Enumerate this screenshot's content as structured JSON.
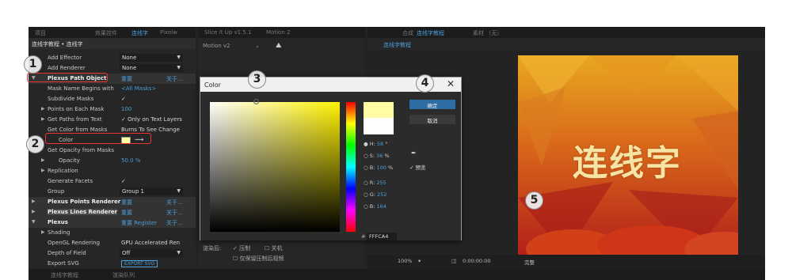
{
  "effect_panel": {
    "tabs": [
      "项目",
      "效果控件",
      "连线字",
      "Pixelw"
    ],
    "title": "连线字教程 • 连线字",
    "rows": [
      {
        "label": "Add Effector",
        "value": "None"
      },
      {
        "label": "Add Renderer",
        "value": "None"
      },
      {
        "label": "Plexus Path Object",
        "value": "重置",
        "extra": "关于..."
      },
      {
        "label": "Mask Name Begins with",
        "value": "<All Masks>"
      },
      {
        "label": "Subdivide Masks",
        "value": "✓"
      },
      {
        "label": "Points on Each Mask",
        "value": "100"
      },
      {
        "label": "Get Paths from Text",
        "value": "✓ Only on Text Layers"
      },
      {
        "label": "Get Color from Masks",
        "value": "Burns To See Change"
      },
      {
        "label": "Color",
        "value": ""
      },
      {
        "label": "Get Opacity from Masks",
        "value": ""
      },
      {
        "label": "Opacity",
        "value": "50.0 %"
      },
      {
        "label": "Replication",
        "value": ""
      },
      {
        "label": "Generate Facets",
        "value": "✓"
      },
      {
        "label": "Group",
        "value": "Group 1"
      },
      {
        "label": "Plexus Points Renderer",
        "value": "重置",
        "extra": "关于..."
      },
      {
        "label": "Plexus Lines Renderer",
        "value": "重置",
        "extra": "关于..."
      },
      {
        "label": "Plexus",
        "value": "重置  Register",
        "extra": "关于..."
      },
      {
        "label": "Shading",
        "value": ""
      },
      {
        "label": "OpenGL Rendering",
        "value": "GPU Accelerated Ren"
      },
      {
        "label": "Depth of Field",
        "value": "Off"
      },
      {
        "label": "Export SVG",
        "value": "EXPORT SVG"
      }
    ]
  },
  "middle_panel": {
    "tabs": [
      "Slice It Up v1.5.1",
      "Motion 2"
    ],
    "preset": "Motion v2",
    "bottom_label": "渲染后:",
    "checks": [
      "压制",
      "关机",
      "仅保留压制后视频"
    ]
  },
  "comp_panel": {
    "tab_prefix": "合成",
    "tab_name": "连线字教程",
    "tab_footage": "素材 （无）",
    "sub_tab": "连线字教程",
    "canvas_text": "连线字",
    "zoom": "100%",
    "timecode": "0:00:00:00",
    "view": "完整"
  },
  "bottom_tabs": [
    "连线字教程",
    "渲染队列"
  ],
  "color_dialog": {
    "title": "Color",
    "ok": "确定",
    "cancel": "取消",
    "preview_label": "预览",
    "fields": [
      {
        "label": "H:",
        "value": "58",
        "unit": "°"
      },
      {
        "label": "S:",
        "value": "36",
        "unit": "%"
      },
      {
        "label": "B:",
        "value": "100",
        "unit": "%"
      },
      {
        "label": "R:",
        "value": "255",
        "unit": ""
      },
      {
        "label": "G:",
        "value": "252",
        "unit": ""
      },
      {
        "label": "B:",
        "value": "164",
        "unit": ""
      }
    ],
    "hex": "FFFCA4"
  },
  "markers": [
    "1",
    "2",
    "3",
    "4",
    "5"
  ],
  "colors": {
    "selected": "#FFFCA4",
    "accent": "#4a9eda",
    "marker_ring": "#e33"
  }
}
